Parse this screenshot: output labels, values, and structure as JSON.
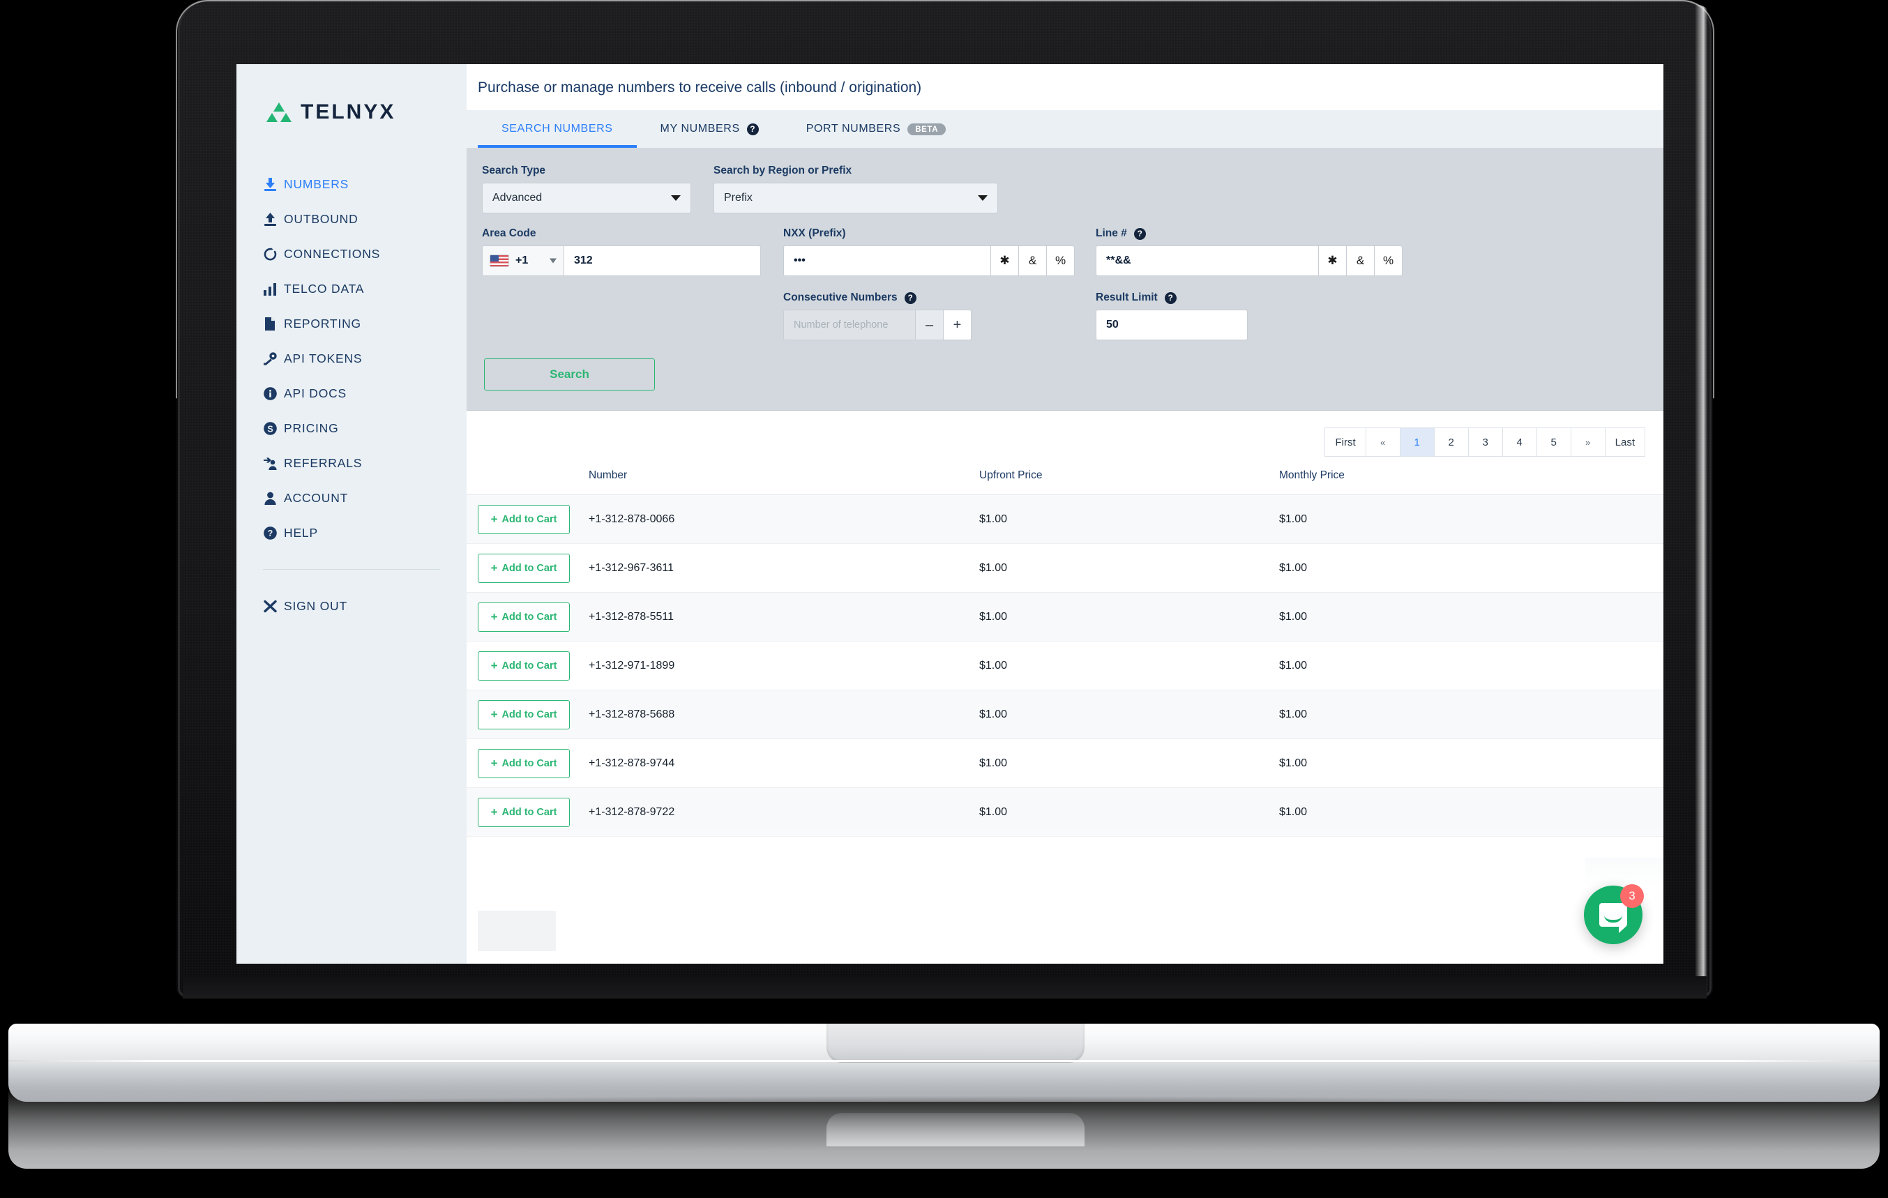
{
  "brand": {
    "name": "TELNYX",
    "logo_icon": "telnyx-triangle-logo",
    "green": "#22b573",
    "blue": "#2d7ff9",
    "navy": "#1c3a63"
  },
  "sidebar": {
    "items": [
      {
        "label": "NUMBERS",
        "icon": "download-icon",
        "active": true
      },
      {
        "label": "OUTBOUND",
        "icon": "upload-icon",
        "active": false
      },
      {
        "label": "CONNECTIONS",
        "icon": "refresh-icon",
        "active": false
      },
      {
        "label": "TELCO DATA",
        "icon": "bar-chart-icon",
        "active": false
      },
      {
        "label": "REPORTING",
        "icon": "document-icon",
        "active": false
      },
      {
        "label": "API TOKENS",
        "icon": "key-icon",
        "active": false
      },
      {
        "label": "API DOCS",
        "icon": "info-icon",
        "active": false
      },
      {
        "label": "PRICING",
        "icon": "dollar-icon",
        "active": false
      },
      {
        "label": "REFERRALS",
        "icon": "referral-icon",
        "active": false
      },
      {
        "label": "ACCOUNT",
        "icon": "user-icon",
        "active": false
      },
      {
        "label": "HELP",
        "icon": "question-icon",
        "active": false
      }
    ],
    "sign_out": {
      "label": "SIGN OUT",
      "icon": "close-x-icon"
    }
  },
  "header": {
    "page_title": "Purchase or manage numbers to receive calls (inbound / origination)"
  },
  "tabs": [
    {
      "label": "SEARCH NUMBERS",
      "active": true,
      "help": false,
      "badge": null
    },
    {
      "label": "MY NUMBERS",
      "active": false,
      "help": true,
      "badge": null
    },
    {
      "label": "PORT NUMBERS",
      "active": false,
      "help": false,
      "badge": "BETA"
    }
  ],
  "search_form": {
    "search_type": {
      "label": "Search Type",
      "value": "Advanced"
    },
    "region_or_prefix": {
      "label": "Search by Region or Prefix",
      "value": "Prefix"
    },
    "area_code": {
      "label": "Area Code",
      "country_code": "+1",
      "country_flag": "us-flag-icon",
      "value": "312"
    },
    "nxx": {
      "label": "NXX (Prefix)",
      "value": "•••",
      "wildcards": [
        "✱",
        "&",
        "%"
      ]
    },
    "line_number": {
      "label": "Line #",
      "value": "**&&",
      "help": true,
      "wildcards": [
        "✱",
        "&",
        "%"
      ]
    },
    "consecutive_numbers": {
      "label": "Consecutive Numbers",
      "help": true,
      "placeholder": "Number of telephone",
      "value": "",
      "minus": "–",
      "plus": "+"
    },
    "result_limit": {
      "label": "Result Limit",
      "help": true,
      "value": "50"
    },
    "search_button": "Search"
  },
  "pagination": {
    "first": "First",
    "prev": "«",
    "pages": [
      "1",
      "2",
      "3",
      "4",
      "5"
    ],
    "active_page": "1",
    "next": "»",
    "last": "Last"
  },
  "results_table": {
    "columns": [
      "",
      "Number",
      "Upfront Price",
      "Monthly Price"
    ],
    "add_to_cart_label": "Add to Cart",
    "rows": [
      {
        "number": "+1-312-878-0066",
        "upfront": "$1.00",
        "monthly": "$1.00"
      },
      {
        "number": "+1-312-967-3611",
        "upfront": "$1.00",
        "monthly": "$1.00"
      },
      {
        "number": "+1-312-878-5511",
        "upfront": "$1.00",
        "monthly": "$1.00"
      },
      {
        "number": "+1-312-971-1899",
        "upfront": "$1.00",
        "monthly": "$1.00"
      },
      {
        "number": "+1-312-878-5688",
        "upfront": "$1.00",
        "monthly": "$1.00"
      },
      {
        "number": "+1-312-878-9744",
        "upfront": "$1.00",
        "monthly": "$1.00"
      },
      {
        "number": "+1-312-878-9722",
        "upfront": "$1.00",
        "monthly": "$1.00"
      }
    ]
  },
  "chat_widget": {
    "icon": "chat-bubble-icon",
    "unread_count": "3"
  }
}
